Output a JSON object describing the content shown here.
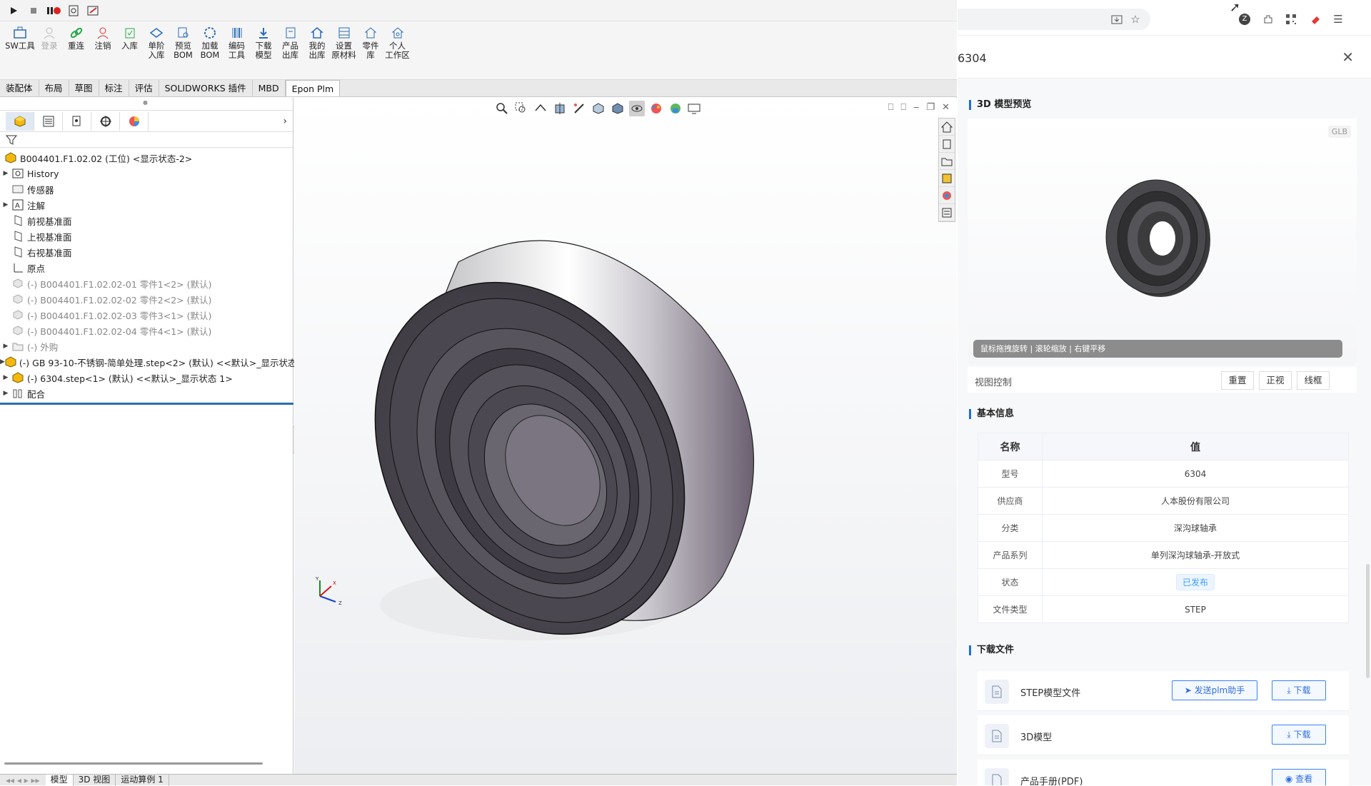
{
  "quickbar": {
    "icons": [
      "play-icon",
      "stop-icon",
      "pause-record-icon",
      "macro-icon",
      "edit-macro-icon"
    ]
  },
  "commands": [
    {
      "label": "SW工具",
      "icon": "sw-tool-icon",
      "enabled": true
    },
    {
      "label": "登录",
      "icon": "user-icon",
      "enabled": false
    },
    {
      "label": "重连",
      "icon": "link-icon",
      "enabled": true
    },
    {
      "label": "注销",
      "icon": "logout-user-icon",
      "enabled": true
    },
    {
      "label": "入库",
      "icon": "checkin-icon",
      "enabled": true
    },
    {
      "label": "单阶入库",
      "icon": "single-level-icon",
      "enabled": true
    },
    {
      "label": "预览BOM",
      "icon": "preview-bom-icon",
      "enabled": true
    },
    {
      "label": "加载BOM",
      "icon": "load-bom-icon",
      "enabled": true
    },
    {
      "label": "编码工具",
      "icon": "barcode-icon",
      "enabled": true
    },
    {
      "label": "下载模型",
      "icon": "download-model-icon",
      "enabled": true
    },
    {
      "label": "产品出库",
      "icon": "product-out-icon",
      "enabled": true
    },
    {
      "label": "我的出库",
      "icon": "my-out-icon",
      "enabled": true
    },
    {
      "label": "设置原材料",
      "icon": "material-icon",
      "enabled": true
    },
    {
      "label": "零件库",
      "icon": "parts-lib-icon",
      "enabled": true
    },
    {
      "label": "个人工作区",
      "icon": "workspace-icon",
      "enabled": true
    }
  ],
  "tabs": [
    "装配体",
    "布局",
    "草图",
    "标注",
    "评估",
    "SOLIDWORKS 插件",
    "MBD",
    "Epon Plm"
  ],
  "active_tab": "Epon Plm",
  "tree": {
    "root": "B004401.F1.02.02 (工位) <显示状态-2>",
    "items": [
      {
        "label": "History",
        "arrow": true,
        "icon": "history-icon",
        "grey": false
      },
      {
        "label": "传感器",
        "arrow": false,
        "icon": "sensor-icon",
        "grey": false
      },
      {
        "label": "注解",
        "arrow": true,
        "icon": "annotation-icon",
        "grey": false
      },
      {
        "label": "前视基准面",
        "arrow": false,
        "icon": "plane-icon",
        "grey": false
      },
      {
        "label": "上视基准面",
        "arrow": false,
        "icon": "plane-icon",
        "grey": false
      },
      {
        "label": "右视基准面",
        "arrow": false,
        "icon": "plane-icon",
        "grey": false
      },
      {
        "label": "原点",
        "arrow": false,
        "icon": "origin-icon",
        "grey": false
      },
      {
        "label": "(-) B004401.F1.02.02-01 零件1<2> (默认)",
        "arrow": false,
        "icon": "part-icon",
        "grey": true
      },
      {
        "label": "(-) B004401.F1.02.02-02 零件2<2> (默认)",
        "arrow": false,
        "icon": "part-icon",
        "grey": true
      },
      {
        "label": "(-) B004401.F1.02.02-03 零件3<1> (默认)",
        "arrow": false,
        "icon": "part-icon",
        "grey": true
      },
      {
        "label": "(-) B004401.F1.02.02-04 零件4<1> (默认)",
        "arrow": false,
        "icon": "part-icon",
        "grey": true
      },
      {
        "label": "(-) 外购",
        "arrow": true,
        "icon": "folder-icon",
        "grey": true
      },
      {
        "label": "(-) GB 93-10-不锈钢-简单处理.step<2> (默认) <<默认>_显示状态",
        "arrow": true,
        "icon": "assembly-icon",
        "grey": false
      },
      {
        "label": "(-) 6304.step<1> (默认) <<默认>_显示状态 1>",
        "arrow": true,
        "icon": "assembly-icon",
        "grey": false
      },
      {
        "label": "配合",
        "arrow": true,
        "icon": "mates-icon",
        "grey": false
      }
    ]
  },
  "bottom_tabs": [
    "模型",
    "3D 视图",
    "运动算例 1"
  ],
  "drawer": {
    "title": "6304",
    "preview_title": "3D 模型预览",
    "format_badge": "GLB",
    "hint": "鼠标拖拽旋转 | 滚轮缩放 | 右键平移",
    "view_control_label": "视图控制",
    "view_buttons": [
      "重置",
      "正视",
      "线框"
    ],
    "info_title": "基本信息",
    "table_headers": [
      "名称",
      "值"
    ],
    "rows": [
      {
        "k": "型号",
        "v": "6304"
      },
      {
        "k": "供应商",
        "v": "人本股份有限公司"
      },
      {
        "k": "分类",
        "v": "深沟球轴承"
      },
      {
        "k": "产品系列",
        "v": "单列深沟球轴承-开放式"
      },
      {
        "k": "状态",
        "v": "已发布"
      },
      {
        "k": "文件类型",
        "v": "STEP"
      }
    ],
    "download_title": "下载文件",
    "files": [
      {
        "name": "STEP模型文件",
        "send": "发送plm助手",
        "action": "下载"
      },
      {
        "name": "3D模型",
        "action": "下载"
      },
      {
        "name": "产品手册(PDF)",
        "action": "查看"
      }
    ]
  },
  "colors": {
    "accent": "#1f6fd9",
    "selection": "#2b6cb7",
    "badge": "#409eff"
  }
}
